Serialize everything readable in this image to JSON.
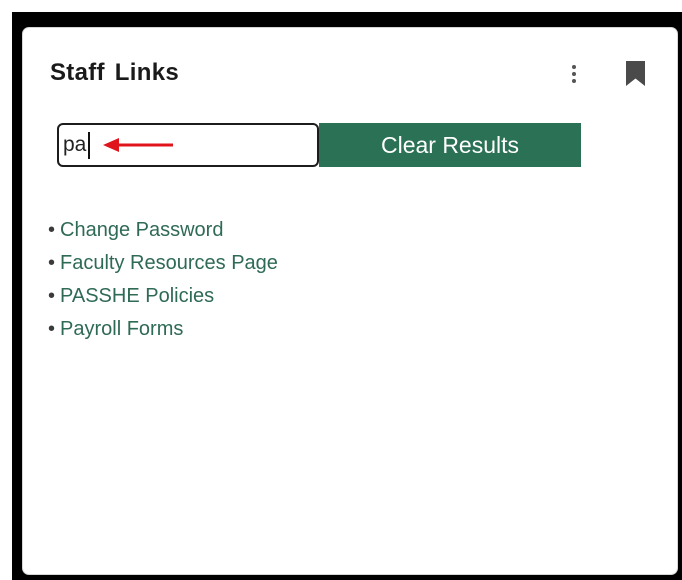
{
  "card": {
    "title": "Staff Links"
  },
  "icons": {
    "menu": "more-vertical-icon",
    "bookmark": "bookmark-icon",
    "annotation": "red-arrow-left"
  },
  "search": {
    "value": "pa",
    "placeholder": ""
  },
  "clear_button": {
    "label": "Clear Results"
  },
  "results": [
    {
      "bullet": "•",
      "label": "Change Password"
    },
    {
      "bullet": "•",
      "label": "Faculty Resources Page"
    },
    {
      "bullet": "•",
      "label": "PASSHE Policies"
    },
    {
      "bullet": "•",
      "label": "Payroll Forms"
    }
  ],
  "colors": {
    "accent": "#2b7155",
    "link": "#2f6a55",
    "annotation": "#e0141b"
  }
}
